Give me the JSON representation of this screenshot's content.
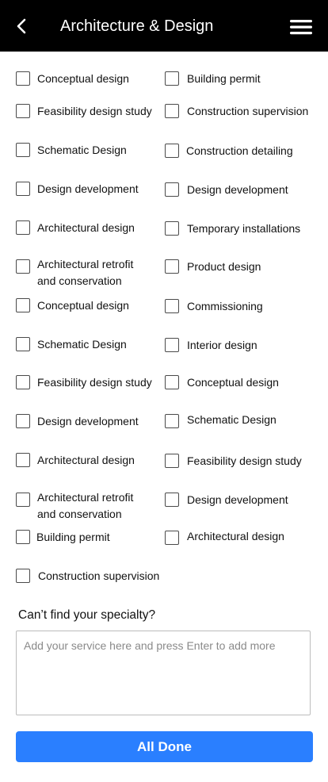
{
  "header": {
    "title": "Architecture & Design",
    "back_icon": "chevron-left-icon",
    "menu_icon": "hamburger-menu-icon",
    "background": "#000000"
  },
  "specialties": {
    "left": [
      "Conceptual design",
      "Feasibility design study",
      "Schematic Design",
      "Design development",
      "Architectural design",
      "Architectural retrofit\nand conservation",
      "Conceptual design",
      "Schematic Design",
      "Feasibility design study",
      "Design development",
      "Architectural design",
      "Architectural retrofit\n and conservation",
      "Building permit",
      "Construction supervision"
    ],
    "right": [
      "Building permit",
      "Construction supervision",
      "Construction detailing",
      "Design development",
      "Temporary installations",
      "Product design",
      "Commissioning",
      "Interior design",
      "Conceptual design",
      "Schematic Design",
      "Feasibility design study",
      "Design development",
      "Architectural design"
    ]
  },
  "custom": {
    "heading": "Can’t find your specialty?",
    "placeholder": "Add your service here and press Enter to add more",
    "value": ""
  },
  "actions": {
    "done_label": "All Done",
    "done_color": "#2a7fff"
  }
}
